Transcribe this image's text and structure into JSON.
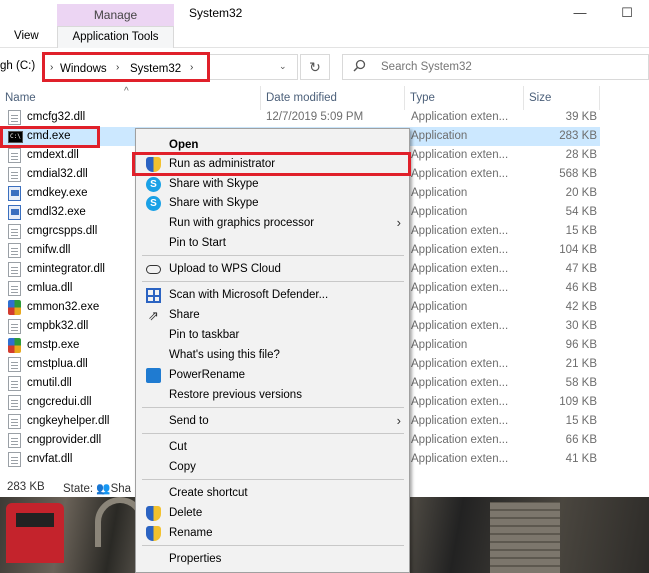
{
  "window": {
    "title": "System32",
    "minimize_glyph": "—",
    "maximize_glyph": "☐"
  },
  "ribbon": {
    "manage_label": "Manage",
    "app_tools_label": "Application Tools",
    "view_label": "View"
  },
  "address": {
    "prefix": "gh (C:)",
    "crumbs": [
      "Windows",
      "System32"
    ],
    "separator": "›",
    "dropdown_glyph": "⌄",
    "refresh_glyph": "↻"
  },
  "search": {
    "placeholder": "Search System32"
  },
  "columns": {
    "name": "Name",
    "date": "Date modified",
    "type": "Type",
    "size": "Size"
  },
  "files": [
    {
      "name": "cmcfg32.dll",
      "date": "12/7/2019 5:09 PM",
      "type": "Application exten...",
      "size": "39 KB",
      "icon": "dll-icon"
    },
    {
      "name": "cmd.exe",
      "date": "",
      "type": "Application",
      "size": "283 KB",
      "icon": "cmd-icon"
    },
    {
      "name": "cmdext.dll",
      "date": "",
      "type": "Application exten...",
      "size": "28 KB",
      "icon": "dll-icon"
    },
    {
      "name": "cmdial32.dll",
      "date": "",
      "type": "Application exten...",
      "size": "568 KB",
      "icon": "dll-icon"
    },
    {
      "name": "cmdkey.exe",
      "date": "",
      "type": "Application",
      "size": "20 KB",
      "icon": "exe-icon"
    },
    {
      "name": "cmdl32.exe",
      "date": "",
      "type": "Application",
      "size": "54 KB",
      "icon": "exe-icon"
    },
    {
      "name": "cmgrcspps.dll",
      "date": "",
      "type": "Application exten...",
      "size": "15 KB",
      "icon": "dll-icon"
    },
    {
      "name": "cmifw.dll",
      "date": "",
      "type": "Application exten...",
      "size": "104 KB",
      "icon": "dll-icon"
    },
    {
      "name": "cmintegrator.dll",
      "date": "",
      "type": "Application exten...",
      "size": "47 KB",
      "icon": "dll-icon"
    },
    {
      "name": "cmlua.dll",
      "date": "",
      "type": "Application exten...",
      "size": "46 KB",
      "icon": "dll-icon"
    },
    {
      "name": "cmmon32.exe",
      "date": "",
      "type": "Application",
      "size": "42 KB",
      "icon": "color-app-icon"
    },
    {
      "name": "cmpbk32.dll",
      "date": "",
      "type": "Application exten...",
      "size": "30 KB",
      "icon": "dll-icon"
    },
    {
      "name": "cmstp.exe",
      "date": "",
      "type": "Application",
      "size": "96 KB",
      "icon": "color-app-icon"
    },
    {
      "name": "cmstplua.dll",
      "date": "",
      "type": "Application exten...",
      "size": "21 KB",
      "icon": "dll-icon"
    },
    {
      "name": "cmutil.dll",
      "date": "",
      "type": "Application exten...",
      "size": "58 KB",
      "icon": "dll-icon"
    },
    {
      "name": "cngcredui.dll",
      "date": "",
      "type": "Application exten...",
      "size": "109 KB",
      "icon": "dll-icon"
    },
    {
      "name": "cngkeyhelper.dll",
      "date": "",
      "type": "Application exten...",
      "size": "15 KB",
      "icon": "dll-icon"
    },
    {
      "name": "cngprovider.dll",
      "date": "",
      "type": "Application exten...",
      "size": "66 KB",
      "icon": "dll-icon"
    },
    {
      "name": "cnvfat.dll",
      "date": "",
      "type": "Application exten...",
      "size": "41 KB",
      "icon": "dll-icon"
    }
  ],
  "status": {
    "size": "283 KB",
    "state": "State:",
    "shared": "Sha"
  },
  "context_menu": {
    "open": "Open",
    "run_as_admin": "Run as administrator",
    "share_skype_1": "Share with Skype",
    "share_skype_2": "Share with Skype",
    "run_gpu": "Run with graphics processor",
    "pin_start": "Pin to Start",
    "upload_wps": "Upload to WPS Cloud",
    "scan_defender": "Scan with Microsoft Defender...",
    "share": "Share",
    "pin_taskbar": "Pin to taskbar",
    "whats_using": "What's using this file?",
    "power_rename": "PowerRename",
    "restore_prev": "Restore previous versions",
    "send_to": "Send to",
    "cut": "Cut",
    "copy": "Copy",
    "create_shortcut": "Create shortcut",
    "delete": "Delete",
    "rename": "Rename",
    "properties": "Properties",
    "submenu_arrow": "›",
    "skype_glyph": "S",
    "share_glyph": "⇗"
  }
}
